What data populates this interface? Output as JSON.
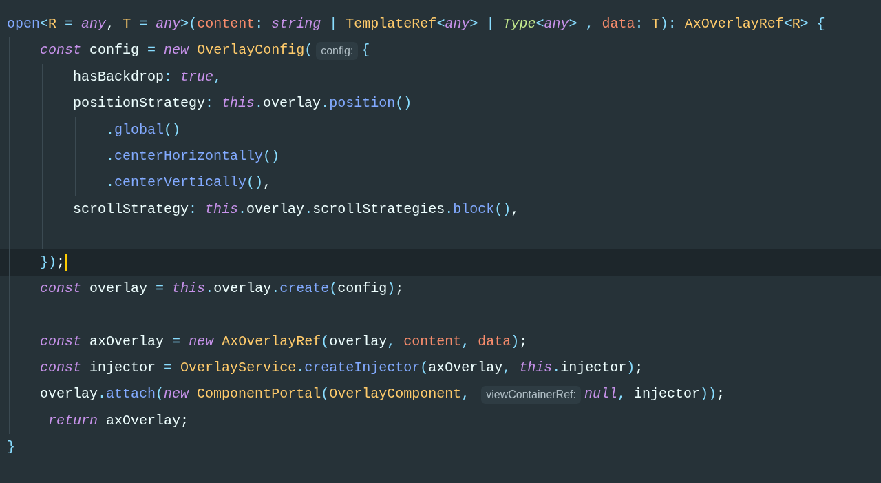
{
  "editor": {
    "lines": [
      {
        "current": false,
        "cursor": false,
        "tokens": [
          {
            "text": "open",
            "kind": "func"
          },
          {
            "text": "<",
            "kind": "punct"
          },
          {
            "text": "R",
            "kind": "type"
          },
          {
            "text": " = ",
            "kind": "punct"
          },
          {
            "text": "any",
            "kind": "keyword"
          },
          {
            "text": ", ",
            "kind": "plain"
          },
          {
            "text": "T",
            "kind": "type"
          },
          {
            "text": " = ",
            "kind": "punct"
          },
          {
            "text": "any",
            "kind": "keyword"
          },
          {
            "text": ">(",
            "kind": "punct"
          },
          {
            "text": "content",
            "kind": "param"
          },
          {
            "text": ": ",
            "kind": "punct"
          },
          {
            "text": "string",
            "kind": "keyword"
          },
          {
            "text": " | ",
            "kind": "punct"
          },
          {
            "text": "TemplateRef",
            "kind": "type"
          },
          {
            "text": "<",
            "kind": "punct"
          },
          {
            "text": "any",
            "kind": "keyword"
          },
          {
            "text": ">",
            "kind": "punct"
          },
          {
            "text": " | ",
            "kind": "punct"
          },
          {
            "text": "Type",
            "kind": "typename"
          },
          {
            "text": "<",
            "kind": "punct"
          },
          {
            "text": "any",
            "kind": "keyword"
          },
          {
            "text": ">",
            "kind": "punct"
          },
          {
            "text": " , ",
            "kind": "punct"
          },
          {
            "text": "data",
            "kind": "param"
          },
          {
            "text": ": ",
            "kind": "punct"
          },
          {
            "text": "T",
            "kind": "type"
          },
          {
            "text": "): ",
            "kind": "punct"
          },
          {
            "text": "AxOverlayRef",
            "kind": "type"
          },
          {
            "text": "<",
            "kind": "punct"
          },
          {
            "text": "R",
            "kind": "type"
          },
          {
            "text": "> {",
            "kind": "punct"
          }
        ]
      },
      {
        "current": false,
        "cursor": false,
        "tokens": [
          {
            "text": "    const",
            "kind": "keyword"
          },
          {
            "text": " config ",
            "kind": "plain"
          },
          {
            "text": "= ",
            "kind": "punct"
          },
          {
            "text": "new",
            "kind": "keyword"
          },
          {
            "text": " OverlayConfig",
            "kind": "type"
          },
          {
            "text": "(",
            "kind": "punct"
          },
          {
            "text": "config:",
            "kind": "hint"
          },
          {
            "text": "{",
            "kind": "punct"
          }
        ]
      },
      {
        "current": false,
        "cursor": false,
        "tokens": [
          {
            "text": "        hasBackdrop",
            "kind": "plain"
          },
          {
            "text": ": ",
            "kind": "punct"
          },
          {
            "text": "true",
            "kind": "keyword"
          },
          {
            "text": ",",
            "kind": "punct"
          }
        ]
      },
      {
        "current": false,
        "cursor": false,
        "tokens": [
          {
            "text": "        positionStrategy",
            "kind": "plain"
          },
          {
            "text": ": ",
            "kind": "punct"
          },
          {
            "text": "this",
            "kind": "keyword"
          },
          {
            "text": ".",
            "kind": "punct"
          },
          {
            "text": "overlay",
            "kind": "plain"
          },
          {
            "text": ".",
            "kind": "punct"
          },
          {
            "text": "position",
            "kind": "func"
          },
          {
            "text": "()",
            "kind": "punct"
          }
        ]
      },
      {
        "current": false,
        "cursor": false,
        "tokens": [
          {
            "text": "            .",
            "kind": "punct"
          },
          {
            "text": "global",
            "kind": "func"
          },
          {
            "text": "()",
            "kind": "punct"
          }
        ]
      },
      {
        "current": false,
        "cursor": false,
        "tokens": [
          {
            "text": "            .",
            "kind": "punct"
          },
          {
            "text": "centerHorizontally",
            "kind": "func"
          },
          {
            "text": "()",
            "kind": "punct"
          }
        ]
      },
      {
        "current": false,
        "cursor": false,
        "tokens": [
          {
            "text": "            .",
            "kind": "punct"
          },
          {
            "text": "centerVertically",
            "kind": "func"
          },
          {
            "text": "()",
            "kind": "punct"
          },
          {
            "text": ",",
            "kind": "plain"
          }
        ]
      },
      {
        "current": false,
        "cursor": false,
        "tokens": [
          {
            "text": "        scrollStrategy",
            "kind": "plain"
          },
          {
            "text": ": ",
            "kind": "punct"
          },
          {
            "text": "this",
            "kind": "keyword"
          },
          {
            "text": ".",
            "kind": "punct"
          },
          {
            "text": "overlay",
            "kind": "plain"
          },
          {
            "text": ".",
            "kind": "punct"
          },
          {
            "text": "scrollStrategies",
            "kind": "plain"
          },
          {
            "text": ".",
            "kind": "punct"
          },
          {
            "text": "block",
            "kind": "func"
          },
          {
            "text": "()",
            "kind": "punct"
          },
          {
            "text": ",",
            "kind": "plain"
          }
        ]
      },
      {
        "current": false,
        "cursor": false
      },
      {
        "current": true,
        "cursor": true,
        "tokens": [
          {
            "text": "    })",
            "kind": "punct"
          },
          {
            "text": ";",
            "kind": "plain"
          }
        ]
      },
      {
        "current": false,
        "cursor": false,
        "tokens": [
          {
            "text": "    const",
            "kind": "keyword"
          },
          {
            "text": " overlay ",
            "kind": "plain"
          },
          {
            "text": "= ",
            "kind": "punct"
          },
          {
            "text": "this",
            "kind": "keyword"
          },
          {
            "text": ".",
            "kind": "punct"
          },
          {
            "text": "overlay",
            "kind": "plain"
          },
          {
            "text": ".",
            "kind": "punct"
          },
          {
            "text": "create",
            "kind": "func"
          },
          {
            "text": "(",
            "kind": "punct"
          },
          {
            "text": "config",
            "kind": "plain"
          },
          {
            "text": ")",
            "kind": "punct"
          },
          {
            "text": ";",
            "kind": "plain"
          }
        ]
      },
      {
        "current": false,
        "cursor": false
      },
      {
        "current": false,
        "cursor": false,
        "tokens": [
          {
            "text": "    const",
            "kind": "keyword"
          },
          {
            "text": " axOverlay ",
            "kind": "plain"
          },
          {
            "text": "= ",
            "kind": "punct"
          },
          {
            "text": "new",
            "kind": "keyword"
          },
          {
            "text": " AxOverlayRef",
            "kind": "type"
          },
          {
            "text": "(",
            "kind": "punct"
          },
          {
            "text": "overlay",
            "kind": "plain"
          },
          {
            "text": ", ",
            "kind": "punct"
          },
          {
            "text": "content",
            "kind": "param"
          },
          {
            "text": ", ",
            "kind": "punct"
          },
          {
            "text": "data",
            "kind": "param"
          },
          {
            "text": ")",
            "kind": "punct"
          },
          {
            "text": ";",
            "kind": "plain"
          }
        ]
      },
      {
        "current": false,
        "cursor": false,
        "tokens": [
          {
            "text": "    const",
            "kind": "keyword"
          },
          {
            "text": " injector ",
            "kind": "plain"
          },
          {
            "text": "= ",
            "kind": "punct"
          },
          {
            "text": "OverlayService",
            "kind": "type"
          },
          {
            "text": ".",
            "kind": "punct"
          },
          {
            "text": "createInjector",
            "kind": "func"
          },
          {
            "text": "(",
            "kind": "punct"
          },
          {
            "text": "axOverlay",
            "kind": "plain"
          },
          {
            "text": ", ",
            "kind": "punct"
          },
          {
            "text": "this",
            "kind": "keyword"
          },
          {
            "text": ".",
            "kind": "punct"
          },
          {
            "text": "injector",
            "kind": "plain"
          },
          {
            "text": ")",
            "kind": "punct"
          },
          {
            "text": ";",
            "kind": "plain"
          }
        ]
      },
      {
        "current": false,
        "cursor": false,
        "tokens": [
          {
            "text": "    overlay",
            "kind": "plain"
          },
          {
            "text": ".",
            "kind": "punct"
          },
          {
            "text": "attach",
            "kind": "func"
          },
          {
            "text": "(",
            "kind": "punct"
          },
          {
            "text": "new",
            "kind": "keyword"
          },
          {
            "text": " ComponentPortal",
            "kind": "type"
          },
          {
            "text": "(",
            "kind": "punct"
          },
          {
            "text": "OverlayComponent",
            "kind": "type"
          },
          {
            "text": ", ",
            "kind": "punct"
          },
          {
            "text": "viewContainerRef:",
            "kind": "hint"
          },
          {
            "text": "null",
            "kind": "keyword"
          },
          {
            "text": ", ",
            "kind": "punct"
          },
          {
            "text": "injector",
            "kind": "plain"
          },
          {
            "text": "))",
            "kind": "punct"
          },
          {
            "text": ";",
            "kind": "plain"
          }
        ]
      },
      {
        "current": false,
        "cursor": false,
        "tokens": [
          {
            "text": "     return",
            "kind": "keyword"
          },
          {
            "text": " axOverlay",
            "kind": "plain"
          },
          {
            "text": ";",
            "kind": "plain"
          }
        ]
      },
      {
        "current": false,
        "cursor": false,
        "tokens": [
          {
            "text": "}",
            "kind": "punct"
          }
        ]
      }
    ]
  }
}
